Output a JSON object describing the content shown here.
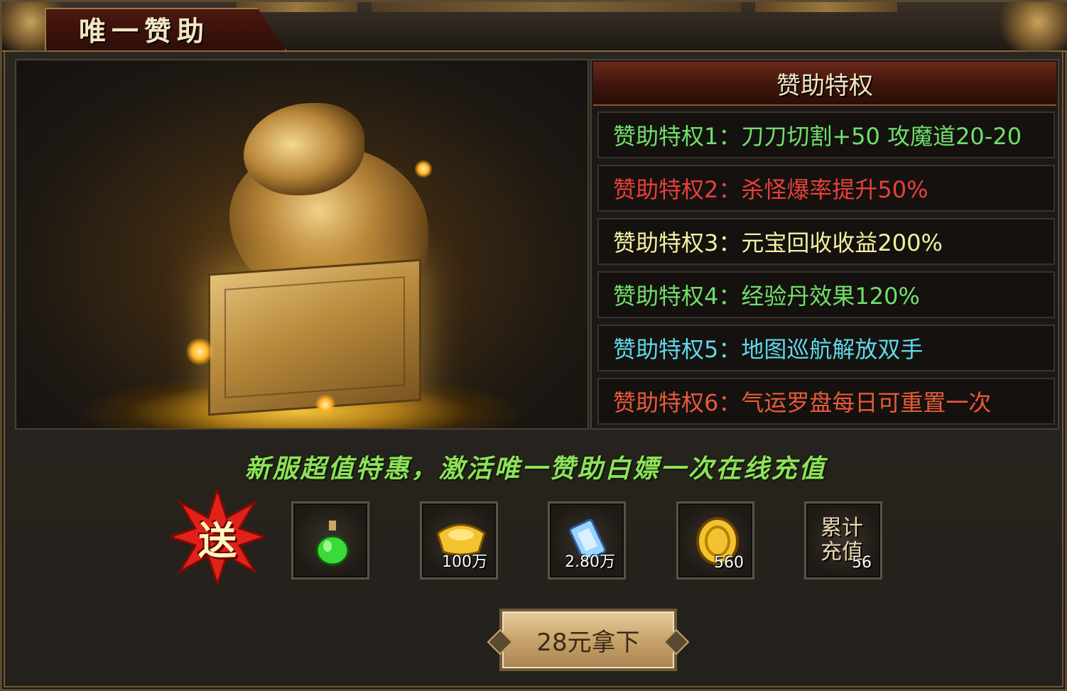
{
  "title": "唯一赞助",
  "privileges": {
    "header": "赞助特权",
    "items": [
      {
        "label": "赞助特权1：刀刀切割+50 攻魔道20-20",
        "color": "#6fe06a"
      },
      {
        "label": "赞助特权2：杀怪爆率提升50%",
        "color": "#e8403a"
      },
      {
        "label": "赞助特权3：元宝回收收益200%",
        "color": "#f5f0a0"
      },
      {
        "label": "赞助特权4：经验丹效果120%",
        "color": "#6fe06a"
      },
      {
        "label": "赞助特权5：地图巡航解放双手",
        "color": "#5fd8e8"
      },
      {
        "label": "赞助特权6：气运罗盘每日可重置一次",
        "color": "#e85a3a"
      }
    ]
  },
  "promo": {
    "text": "新服超值特惠，激活唯一赞助白嫖一次在线充值",
    "gift_badge": "送"
  },
  "rewards": [
    {
      "icon": "green-potion-icon",
      "count": ""
    },
    {
      "icon": "gold-ingot-icon",
      "count": "100万"
    },
    {
      "icon": "blue-scroll-icon",
      "count": "2.80万"
    },
    {
      "icon": "gold-coin-icon",
      "count": "560"
    },
    {
      "icon": "accumulated-recharge-icon",
      "label": "累计充值",
      "count": "56"
    }
  ],
  "buy_button": "28元拿下",
  "colors": {
    "accent_gold": "#c8a36a",
    "promo_green": "#8fe05a",
    "header_red": "#6a2a1a"
  }
}
